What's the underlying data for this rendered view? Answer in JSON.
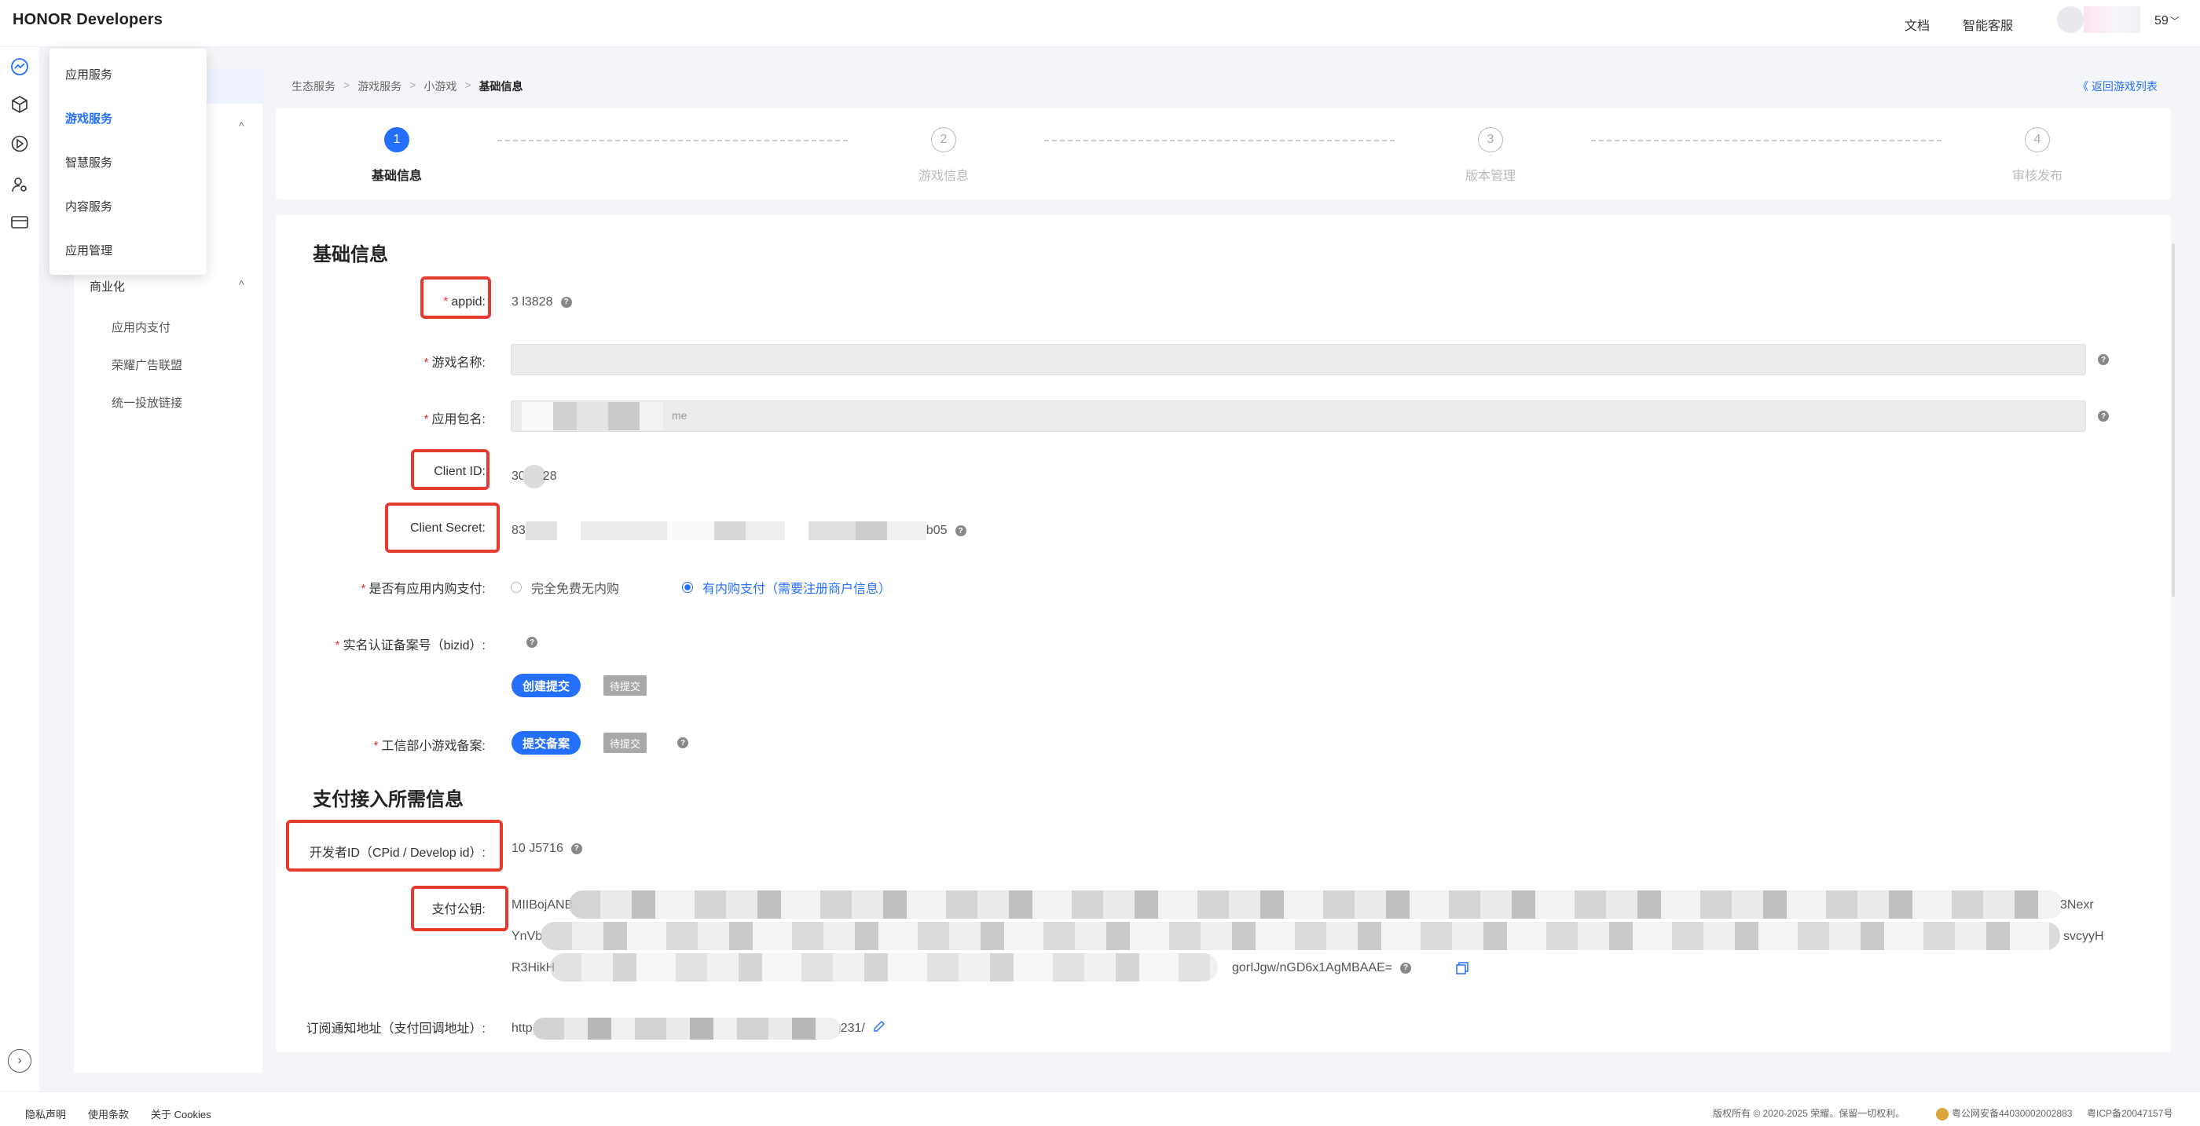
{
  "header": {
    "logo": "HONOR Developers",
    "links": [
      "文档",
      "智能客服"
    ],
    "user_num": "59",
    "chevron": "﹀"
  },
  "rail_icons": [
    "dashboard-icon",
    "cube-icon",
    "gamepad-icon",
    "user-settings-icon",
    "card-icon"
  ],
  "flyout": {
    "items": [
      "应用服务",
      "游戏服务",
      "智慧服务",
      "内容服务",
      "应用管理"
    ],
    "active_index": 1
  },
  "subnav": {
    "group": "商业化",
    "items": [
      "应用内支付",
      "荣耀广告联盟",
      "统一投放链接"
    ],
    "caret": "^"
  },
  "breadcrumb": [
    "生态服务",
    "游戏服务",
    "小游戏",
    "基础信息"
  ],
  "breadcrumb_sep": ">",
  "back_link": "《 返回游戏列表",
  "steps": [
    {
      "num": "1",
      "label": "基础信息"
    },
    {
      "num": "2",
      "label": "游戏信息"
    },
    {
      "num": "3",
      "label": "版本管理"
    },
    {
      "num": "4",
      "label": "审核发布"
    }
  ],
  "form": {
    "section1_title": "基础信息",
    "appid_label": "appid:",
    "appid_value": "3    l3828",
    "game_name_label": "游戏名称:",
    "package_label": "应用包名:",
    "package_suffix": "me",
    "client_id_label": "Client ID:",
    "client_id_prefix": "30",
    "client_id_suffix": "28",
    "client_secret_label": "Client Secret:",
    "client_secret_prefix": "83",
    "client_secret_suffix": "b05",
    "iap_label": "是否有应用内购支付:",
    "iap_option_free": "完全免费无内购",
    "iap_option_paid": "有内购支付（需要注册商户信息）",
    "bizid_label": "实名认证备案号（bizid）:",
    "create_submit": "创建提交",
    "pending": "待提交",
    "miit_label": "工信部小游戏备案:",
    "submit_record": "提交备案",
    "section2_title": "支付接入所需信息",
    "dev_id_label": "开发者ID（CPid / Develop id）:",
    "dev_id_value": "10        J5716",
    "pay_key_label": "支付公钥:",
    "pay_key_line1_start": "MIIBojANB",
    "pay_key_line1_end": "3Nexr",
    "pay_key_line2_start": "YnVb",
    "pay_key_line2_end": "svcyyH",
    "pay_key_line3_start": "R3HikH",
    "pay_key_line3_end": "gorIJgw/nGD6x1AgMBAAE=",
    "notify_label": "订阅通知地址（支付回调地址）:",
    "notify_prefix": "http",
    "notify_suffix": "231/",
    "help_glyph": "?"
  },
  "footer": {
    "links": [
      "隐私声明",
      "使用条款",
      "关于 Cookies"
    ],
    "copyright": "版权所有 © 2020-2025 荣耀。保留一切权利。",
    "police": "粤公网安备44030002002883",
    "icp": "粤ICP备20047157号"
  },
  "colors": {
    "accent": "#256fff",
    "highlight_box": "#e53a2e",
    "required": "#e53935"
  }
}
